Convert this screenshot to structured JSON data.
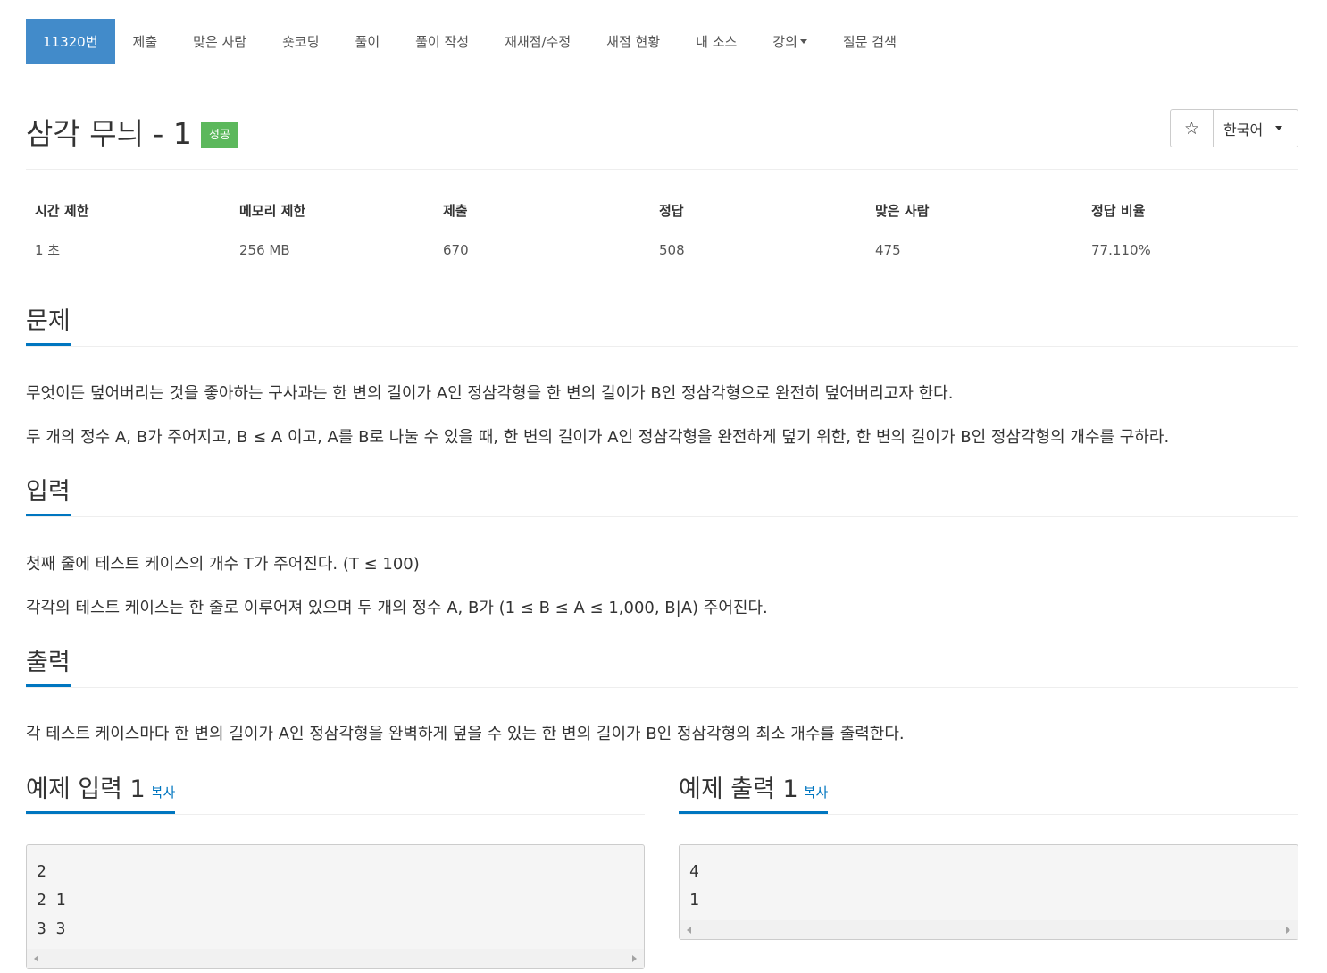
{
  "nav": {
    "items": [
      {
        "label": "11320번",
        "active": true
      },
      {
        "label": "제출"
      },
      {
        "label": "맞은 사람"
      },
      {
        "label": "숏코딩"
      },
      {
        "label": "풀이"
      },
      {
        "label": "풀이 작성"
      },
      {
        "label": "재채점/수정"
      },
      {
        "label": "채점 현황"
      },
      {
        "label": "내 소스"
      },
      {
        "label": "강의"
      },
      {
        "label": "질문 검색"
      }
    ]
  },
  "problem": {
    "title": "삼각 무늬 - 1",
    "status_badge": "성공",
    "star_icon": "☆",
    "language": "한국어"
  },
  "stats": {
    "headers": [
      "시간 제한",
      "메모리 제한",
      "제출",
      "정답",
      "맞은 사람",
      "정답 비율"
    ],
    "values": [
      "1 초",
      "256 MB",
      "670",
      "508",
      "475",
      "77.110%"
    ]
  },
  "sections": {
    "description": {
      "title": "문제",
      "paragraphs": [
        "무엇이든 덮어버리는 것을 좋아하는 구사과는 한 변의 길이가 A인 정삼각형을 한 변의 길이가 B인 정삼각형으로 완전히 덮어버리고자 한다.",
        "두 개의 정수 A, B가 주어지고, B ≤ A 이고, A를 B로 나눌 수 있을 때, 한 변의 길이가 A인 정삼각형을 완전하게 덮기 위한, 한 변의 길이가 B인 정삼각형의 개수를 구하라."
      ]
    },
    "input": {
      "title": "입력",
      "paragraphs": [
        "첫째 줄에 테스트 케이스의 개수 T가 주어진다. (T ≤ 100)",
        "각각의 테스트 케이스는 한 줄로 이루어져 있으며 두 개의 정수 A, B가 (1 ≤ B ≤ A ≤ 1,000, B|A) 주어진다."
      ]
    },
    "output": {
      "title": "출력",
      "paragraphs": [
        "각 테스트 케이스마다 한 변의 길이가 A인 정삼각형을 완벽하게 덮을 수 있는 한 변의 길이가 B인 정삼각형의 최소 개수를 출력한다."
      ]
    }
  },
  "samples": {
    "input": {
      "title": "예제 입력 1",
      "copy_label": "복사",
      "lines": [
        "2",
        "2 1",
        "3 3"
      ]
    },
    "output": {
      "title": "예제 출력 1",
      "copy_label": "복사",
      "lines": [
        "4",
        "1"
      ]
    }
  }
}
